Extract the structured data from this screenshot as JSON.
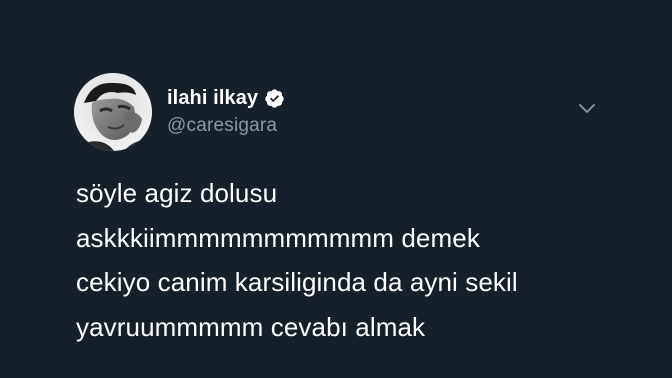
{
  "tweet": {
    "author": {
      "display_name": "ilahi ilkay",
      "handle": "@caresigara",
      "verified": true,
      "avatar_icon": "profile-photo"
    },
    "text_lines": [
      "söyle agiz dolusu",
      "askkkiimmmmmmmmmmm demek",
      "cekiyo canim karsiliginda da ayni sekil",
      "yavruummmmm cevabı almak"
    ],
    "menu_icon": "chevron-down-icon"
  },
  "colors": {
    "background": "#15202b",
    "text_primary": "#ffffff",
    "text_secondary": "#8899a6",
    "chevron": "#8899a6"
  }
}
